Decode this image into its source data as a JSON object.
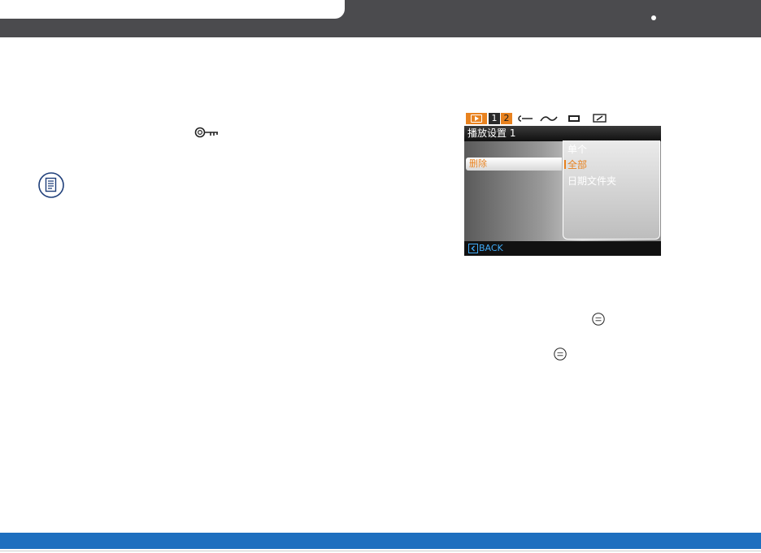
{
  "header": {
    "colors": {
      "bar": "#4b4b4e",
      "tab": "#ffffff"
    }
  },
  "icons": {
    "key": "key-icon",
    "note": "note-icon",
    "func_ok": "func-ok-button-icon"
  },
  "camera_screen": {
    "tabs": {
      "page1": "1",
      "page2": "2"
    },
    "tool_icons": [
      "setup-icon",
      "connection-icon",
      "card-icon",
      "edit-icon"
    ],
    "title": "播放设置 1",
    "menu_item": "删除",
    "options": [
      {
        "label": "单个",
        "selected": false
      },
      {
        "label": "全部",
        "selected": true
      },
      {
        "label": "日期文件夹",
        "selected": false
      }
    ],
    "back_label": "BACK",
    "colors": {
      "accent": "#e8821f",
      "back": "#3fa9f5"
    }
  },
  "footer": {
    "color": "#1e6fbf"
  }
}
